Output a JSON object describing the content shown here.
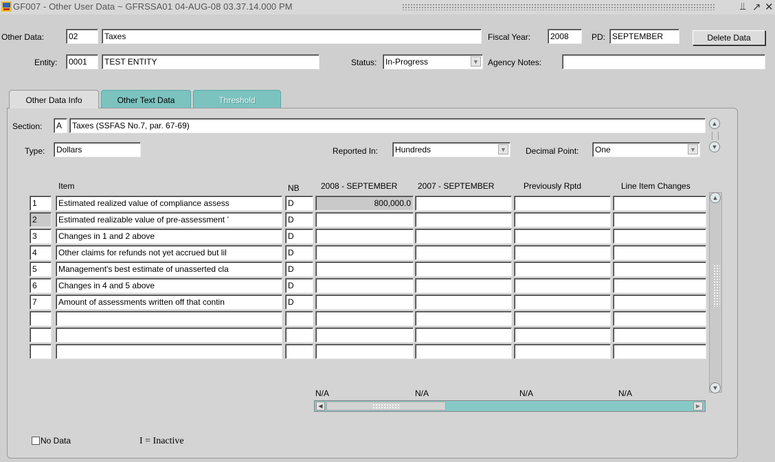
{
  "window": {
    "title": "GF007 - Other User Data ~ GFRSSA01  04-AUG-08 03.37.14.000 PM",
    "controls": [
      "⫫",
      "↗",
      "✕"
    ]
  },
  "header": {
    "other_data_label": "Other Data:",
    "other_data_code": "02",
    "other_data_name": "Taxes",
    "fiscal_year_label": "Fiscal Year:",
    "fiscal_year_value": "2008",
    "pd_label": "PD:",
    "pd_value": "SEPTEMBER",
    "delete_button": "Delete Data",
    "entity_label": "Entity:",
    "entity_code": "0001",
    "entity_name": "TEST ENTITY",
    "status_label": "Status:",
    "status_value": "In-Progress",
    "agency_notes_label": "Agency Notes:",
    "agency_notes_value": ""
  },
  "tabs": [
    {
      "label": "Other Data Info",
      "active": true
    },
    {
      "label": "Other Text Data",
      "active": false
    },
    {
      "label": "Threshold",
      "active": false,
      "disabled": true
    }
  ],
  "section": {
    "label": "Section:",
    "code": "A",
    "name": "Taxes (SSFAS No.7, par. 67-69)",
    "type_label": "Type:",
    "type_value": "Dollars",
    "reported_in_label": "Reported In:",
    "reported_in_value": "Hundreds",
    "decimal_label": "Decimal Point:",
    "decimal_value": "One"
  },
  "grid": {
    "columns": [
      "Item",
      "NB",
      "2008 - SEPTEMBER",
      "2007 - SEPTEMBER",
      "Previously Rptd",
      "Line Item Changes"
    ],
    "rows": [
      {
        "num": "1",
        "item": "Estimated realized value of compliance assess",
        "nb": "D",
        "c1": "800,000.0",
        "c2": "",
        "c3": "",
        "c4": ""
      },
      {
        "num": "2",
        "item": "Estimated realizable value of pre-assessment ’",
        "nb": "D",
        "c1": "",
        "c2": "",
        "c3": "",
        "c4": ""
      },
      {
        "num": "3",
        "item": "Changes in 1 and 2 above",
        "nb": "D",
        "c1": "",
        "c2": "",
        "c3": "",
        "c4": ""
      },
      {
        "num": "4",
        "item": "Other claims for refunds not yet accrued but lil",
        "nb": "D",
        "c1": "",
        "c2": "",
        "c3": "",
        "c4": ""
      },
      {
        "num": "5",
        "item": "Management's best estimate of unasserted cla",
        "nb": "D",
        "c1": "",
        "c2": "",
        "c3": "",
        "c4": ""
      },
      {
        "num": "6",
        "item": "Changes in 4 and 5 above",
        "nb": "D",
        "c1": "",
        "c2": "",
        "c3": "",
        "c4": ""
      },
      {
        "num": "7",
        "item": "Amount of assessments written off that contin",
        "nb": "D",
        "c1": "",
        "c2": "",
        "c3": "",
        "c4": ""
      },
      {
        "num": "",
        "item": "",
        "nb": "",
        "c1": "",
        "c2": "",
        "c3": "",
        "c4": ""
      },
      {
        "num": "",
        "item": "",
        "nb": "",
        "c1": "",
        "c2": "",
        "c3": "",
        "c4": ""
      },
      {
        "num": "",
        "item": "",
        "nb": "",
        "c1": "",
        "c2": "",
        "c3": "",
        "c4": ""
      }
    ],
    "totals": [
      "N/A",
      "N/A",
      "N/A",
      "N/A"
    ]
  },
  "footer": {
    "no_data_label": "No Data",
    "no_data_checked": false,
    "inactive_legend": "I = Inactive"
  },
  "colors": {
    "tab_teal": "#7cc3c0",
    "scroll_teal": "#86c9c6"
  }
}
